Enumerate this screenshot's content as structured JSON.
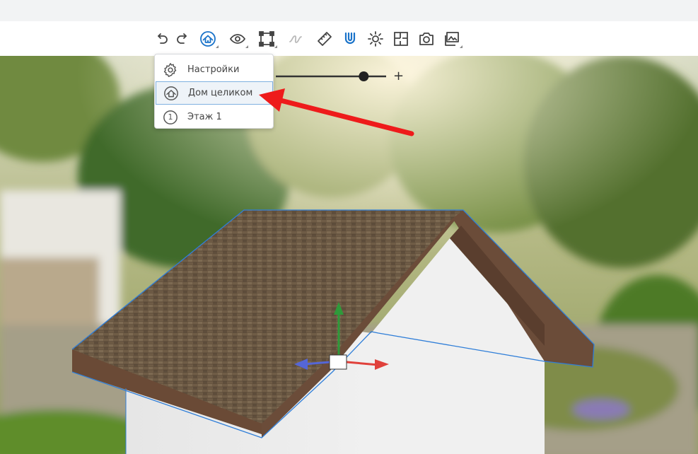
{
  "toolbar": {
    "buttons": [
      {
        "name": "undo-button",
        "icon": "undo-icon"
      },
      {
        "name": "redo-button",
        "icon": "redo-icon"
      },
      {
        "name": "view-mode-button",
        "icon": "house-view-icon",
        "has_dropdown": true
      },
      {
        "name": "visibility-button",
        "icon": "eye-icon",
        "has_dropdown": true
      },
      {
        "name": "select-frame-button",
        "icon": "frame-select-icon",
        "has_dropdown": true
      },
      {
        "name": "curve-tool-button",
        "icon": "curve-icon",
        "disabled": true
      },
      {
        "name": "ruler-button",
        "icon": "ruler-icon"
      },
      {
        "name": "magnet-button",
        "icon": "magnet-icon",
        "active": true
      },
      {
        "name": "lighting-button",
        "icon": "sun-icon"
      },
      {
        "name": "floor-plan-button",
        "icon": "floor-plan-icon"
      },
      {
        "name": "camera-button",
        "icon": "camera-icon"
      },
      {
        "name": "gallery-button",
        "icon": "gallery-icon",
        "has_dropdown": true
      }
    ]
  },
  "dropdown": {
    "items": [
      {
        "label": "Настройки",
        "icon": "gear-icon",
        "active": false
      },
      {
        "label": "Дом целиком",
        "icon": "house-view-icon",
        "active": true
      },
      {
        "label": "Этаж 1",
        "icon": "floor-number-icon",
        "badge": "1",
        "active": false
      }
    ]
  },
  "slider": {
    "plus_label": "+",
    "value": 0.84
  },
  "colors": {
    "accent": "#1a73c9",
    "annotation_arrow": "#ee1b1b",
    "gizmo_y": "#2e9a3a",
    "gizmo_x": "#e0413b",
    "gizmo_z": "#5566d6",
    "selection_outline": "#2f7ed8"
  }
}
